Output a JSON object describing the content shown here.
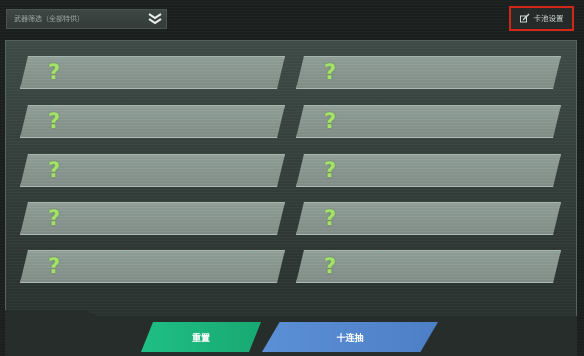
{
  "filter": {
    "label": "武器筛选（全部特供）",
    "icon": "chevron-down-icon"
  },
  "settings": {
    "label": "卡池设置",
    "icon": "edit-icon"
  },
  "cards": [
    {
      "symbol": "?"
    },
    {
      "symbol": "?"
    },
    {
      "symbol": "?"
    },
    {
      "symbol": "?"
    },
    {
      "symbol": "?"
    },
    {
      "symbol": "?"
    },
    {
      "symbol": "?"
    },
    {
      "symbol": "?"
    },
    {
      "symbol": "?"
    },
    {
      "symbol": "?"
    }
  ],
  "buttons": {
    "reset": "重置",
    "ten_draw": "十连抽"
  },
  "colors": {
    "reset": "#1fbf85",
    "ten_draw": "#5b8fd6",
    "highlight_border": "#d3261b",
    "question_mark": "#a4e36a"
  }
}
